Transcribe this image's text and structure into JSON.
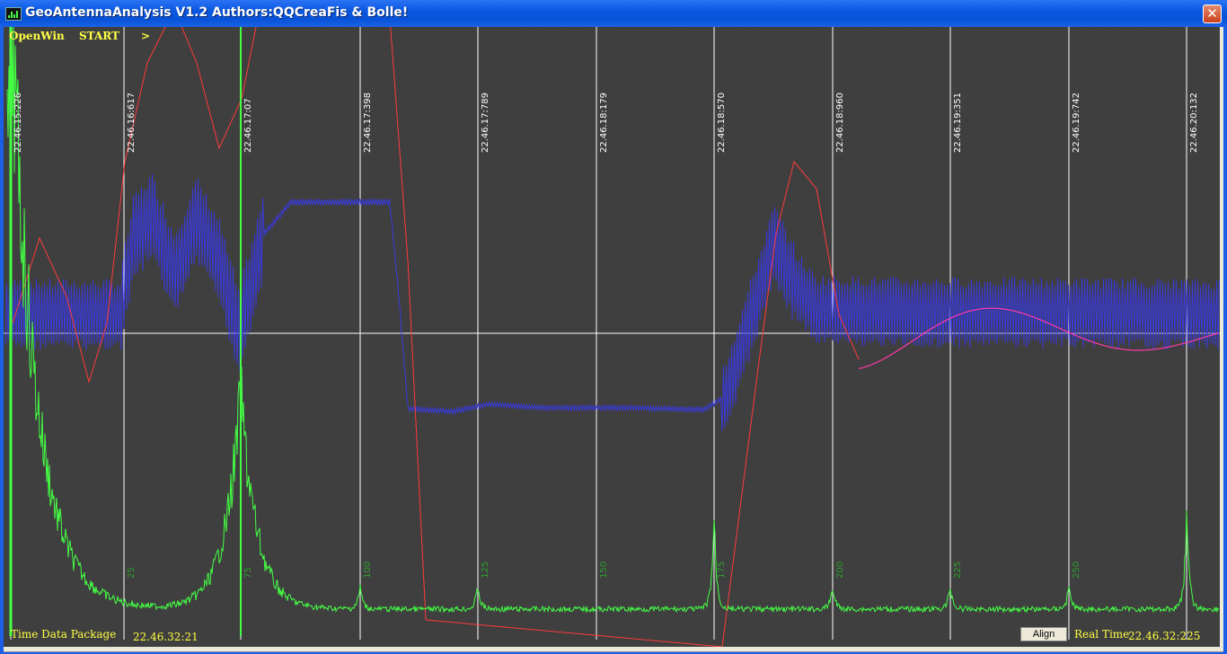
{
  "window": {
    "title": "GeoAntennaAnalysis V1.2 Authors:QQCreaFis & Bolle!",
    "close_glyph": "✕"
  },
  "menu": {
    "open_label": "OpenWin",
    "start_label": "START",
    "next_label": ">"
  },
  "time_markers": [
    "22.46.15:226",
    "22.46.16:617",
    "22.46.17:07",
    "22.46.17:398",
    "22.46.17:789",
    "22.46.18:179",
    "22.46.18:570",
    "22.46.18:960",
    "22.46.19:351",
    "22.46.19:742",
    "22.46.20:132"
  ],
  "sample_markers": [
    "25",
    "75",
    "100",
    "125",
    "150",
    "175",
    "200",
    "225",
    "250"
  ],
  "status": {
    "package_label": "Time Data Package",
    "package_value": "22.46.32:21",
    "align_label": "Align",
    "realtime_label": "Real Time",
    "realtime_value": "22.46.32:225"
  },
  "colors": {
    "background": "#3f3f3f",
    "grid": "#ffffff",
    "blue_trace": "#3a3adc",
    "red_trace": "#ff3a3a",
    "magenta_trace": "#ff3aa8",
    "green_trace": "#44ff44",
    "label_yellow": "#ffff44"
  }
}
